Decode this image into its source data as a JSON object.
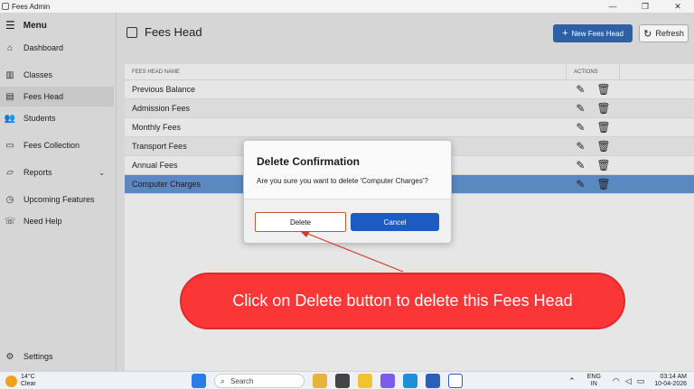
{
  "window": {
    "title": "Fees Admin",
    "controls": [
      "—",
      "❐",
      "✕"
    ]
  },
  "sidebar": {
    "menu_label": "Menu",
    "items": [
      {
        "label": "Dashboard",
        "icon": "home-icon"
      },
      {
        "label": "Classes",
        "icon": "books-icon"
      },
      {
        "label": "Fees Head",
        "icon": "list-icon",
        "active": true
      },
      {
        "label": "Students",
        "icon": "people-icon"
      },
      {
        "label": "Fees Collection",
        "icon": "receipt-icon"
      },
      {
        "label": "Reports",
        "icon": "folder-icon",
        "expandable": true
      },
      {
        "label": "Upcoming Features",
        "icon": "clock-icon"
      },
      {
        "label": "Need Help",
        "icon": "phone-icon"
      }
    ],
    "settings_label": "Settings"
  },
  "header": {
    "title": "Fees Head",
    "new_button": "New Fees Head",
    "refresh_button": "Refresh"
  },
  "table": {
    "columns": [
      "FEES HEAD NAME",
      "ACTIONS"
    ],
    "rows": [
      "Previous Balance",
      "Admission Fees",
      "Monthly Fees",
      "Transport Fees",
      "Annual Fees",
      "Computer Charges"
    ],
    "selected_row": "Computer Charges"
  },
  "dialog": {
    "title": "Delete Confirmation",
    "message": "Are you sure you want to delete 'Computer Charges'?",
    "delete_label": "Delete",
    "cancel_label": "Cancel"
  },
  "callout": {
    "text": "Click on Delete button to delete this Fees Head"
  },
  "taskbar": {
    "weather_temp": "14°C",
    "weather_desc": "Clear",
    "search_placeholder": "Search",
    "lang_line1": "ENG",
    "lang_line2": "IN",
    "time": "03:14 AM",
    "date": "10-04-2026"
  }
}
